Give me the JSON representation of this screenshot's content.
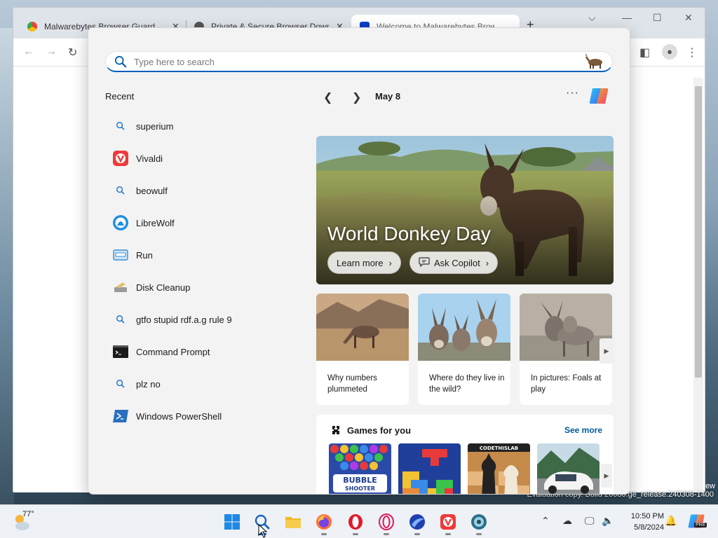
{
  "browser": {
    "tabs": [
      {
        "title": "Malwarebytes Browser Guard",
        "active": false
      },
      {
        "title": "Private & Secure Browser Download",
        "active": false
      },
      {
        "title": "Welcome to Malwarebytes Browser Guard",
        "active": true
      }
    ],
    "evaluation_text": "Evaluation copy. Build 26080.ge_release.240308-1400",
    "edge_label": "ew"
  },
  "search": {
    "placeholder": "Type here to search"
  },
  "recent": {
    "title": "Recent",
    "items": [
      {
        "label": "superium",
        "icon": "search-icon"
      },
      {
        "label": "Vivaldi",
        "icon": "vivaldi-icon"
      },
      {
        "label": "beowulf",
        "icon": "search-icon"
      },
      {
        "label": "LibreWolf",
        "icon": "librewolf-icon"
      },
      {
        "label": "Run",
        "icon": "run-icon"
      },
      {
        "label": "Disk Cleanup",
        "icon": "disk-cleanup-icon"
      },
      {
        "label": "gtfo stupid rdf.a.g rule 9",
        "icon": "search-icon"
      },
      {
        "label": "Command Prompt",
        "icon": "command-prompt-icon"
      },
      {
        "label": "plz no",
        "icon": "search-icon"
      },
      {
        "label": "Windows PowerShell",
        "icon": "powershell-icon"
      }
    ]
  },
  "highlights": {
    "date": "May 8",
    "hero": {
      "title": "World Donkey Day",
      "learn_more": "Learn more",
      "ask_copilot": "Ask Copilot"
    },
    "cards": [
      {
        "text": "Why numbers plummeted"
      },
      {
        "text": "Where do they live in the wild?"
      },
      {
        "text": "In pictures: Foals at play"
      }
    ],
    "games": {
      "title": "Games for you",
      "see_more": "See more",
      "tiles": [
        {
          "name": "Bubble Shooter",
          "logo_text": "BUBBLE SHOOTER"
        },
        {
          "name": "Block puzzle",
          "logo_text": ""
        },
        {
          "name": "Chess",
          "logo_text": "CODETHISLAB"
        },
        {
          "name": "Racing",
          "logo_text": ""
        }
      ]
    }
  },
  "taskbar": {
    "weather_temp": "77°",
    "time": "10:50 PM",
    "date": "5/8/2024",
    "copilot_badge": "PRE"
  },
  "colors": {
    "accent": "#005fb8",
    "panel_bg": "#f3f3f3",
    "taskbar_bg": "#eef1f5"
  }
}
